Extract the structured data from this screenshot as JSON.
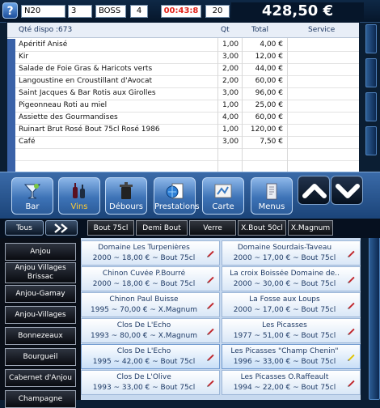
{
  "topbar": {
    "help_label": "?",
    "table": "N20",
    "covers": "3",
    "server": "BOSS",
    "tickets": "4",
    "timer": "00:43:8",
    "count": "20",
    "total": "428,50 €"
  },
  "order": {
    "stock_label": "Qté dispo :673",
    "col_qty": "Qt",
    "col_total": "Total",
    "col_service": "Service",
    "lines": [
      {
        "name": "Apéritif Anisé",
        "qty": "1,00",
        "total": "4,00 €"
      },
      {
        "name": "Kir",
        "qty": "3,00",
        "total": "12,00 €"
      },
      {
        "name": "Salade de Foie Gras & Haricots verts",
        "qty": "2,00",
        "total": "44,00 €"
      },
      {
        "name": "Langoustine en Croustillant d'Avocat",
        "qty": "2,00",
        "total": "60,00 €"
      },
      {
        "name": "Saint Jacques & Bar Rotis aux Girolles",
        "qty": "3,00",
        "total": "96,00 €"
      },
      {
        "name": "Pigeonneau Roti au miel",
        "qty": "1,00",
        "total": "25,00 €"
      },
      {
        "name": "Assiette des Gourmandises",
        "qty": "4,00",
        "total": "60,00 €"
      },
      {
        "name": "Ruinart Brut Rosé Bout 75cl Rosé 1986",
        "qty": "1,00",
        "total": "120,00 €"
      },
      {
        "name": "Café",
        "qty": "3,00",
        "total": "7,50 €"
      }
    ]
  },
  "categories": {
    "bar": "Bar",
    "vins": "Vins",
    "debours": "Débours",
    "prestations": "Prestations",
    "carte": "Carte",
    "menus": "Menus"
  },
  "filters": {
    "tous": "Tous",
    "formats": [
      "Bout 75cl",
      "Demi Bout",
      "Verre",
      "X.Bout 50cl",
      "X.Magnum"
    ]
  },
  "appellations": [
    "Anjou",
    "Anjou Villages Brissac",
    "Anjou-Gamay",
    "Anjou-Villages",
    "Bonnezeaux",
    "Bourgueil",
    "Cabernet d'Anjou",
    "Champagne"
  ],
  "wines_left": [
    {
      "name": "Domaine Les Turpenières",
      "detail": "2000 ~ 18,00 € ~ Bout 75cl"
    },
    {
      "name": "Chinon Cuvée P.Bourré",
      "detail": "2000 ~ 18,00 € ~ Bout 75cl"
    },
    {
      "name": "Chinon Paul Buisse",
      "detail": "1995 ~ 70,00 € ~ X.Magnum"
    },
    {
      "name": "Clos De L'Echo",
      "detail": "1993 ~ 80,00 € ~ X.Magnum"
    },
    {
      "name": "Clos De L'Echo",
      "detail": "1995 ~ 42,00 € ~ Bout 75cl"
    },
    {
      "name": "Clos De L'Olive",
      "detail": "1993 ~ 33,00 € ~ Bout 75cl"
    }
  ],
  "wines_right": [
    {
      "name": "Domaine Sourdais-Taveau",
      "detail": "2000 ~ 17,00 € ~ Bout 75cl"
    },
    {
      "name": "La croix Boissée  Domaine de..",
      "detail": "2000 ~ 30,00 € ~ Bout 75cl"
    },
    {
      "name": "La Fosse aux Loups",
      "detail": "2000 ~ 17,00 € ~ Bout 75cl"
    },
    {
      "name": "Les Picasses",
      "detail": "1977 ~ 51,00 € ~ Bout 75cl"
    },
    {
      "name": "Les Picasses \"Champ Chenin\"",
      "detail": "1996 ~ 33,00 € ~ Bout 75cl"
    },
    {
      "name": "Les Picasses O.Raffeault",
      "detail": "1994 ~ 22,00 € ~ Bout 75cl"
    }
  ],
  "icons": {
    "help": "help-icon",
    "bar": "cocktail-glass-icon",
    "vins": "wine-bottles-icon",
    "debours": "trash-bin-icon",
    "prestations": "globe-document-icon",
    "carte": "map-card-icon",
    "menus": "menu-book-icon",
    "up": "chevron-up-icon",
    "down": "chevron-down-icon",
    "pen": "pen-icon",
    "double_arrow": "double-chevron-right-icon"
  },
  "colors": {
    "accent": "#3a6aa8",
    "active_tab": "#ffcc33",
    "timer": "#e2231a",
    "pen_red": "#c1272d",
    "pen_yellow": "#e2c400"
  }
}
